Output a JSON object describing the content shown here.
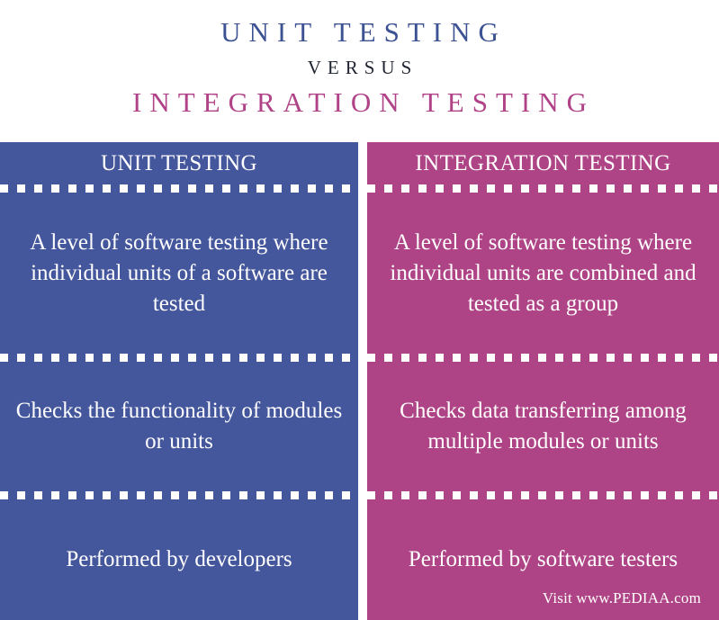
{
  "title": {
    "primary": "UNIT TESTING",
    "versus": "VERSUS",
    "secondary": "INTEGRATION TESTING"
  },
  "colors": {
    "unit_blue": "#44569C",
    "integration_pink": "#AE4486",
    "title_blue": "#3D5293",
    "title_pink": "#B04287",
    "versus_dark": "#1F2430",
    "text_white": "#FFFFFF"
  },
  "table": {
    "headers": [
      "UNIT TESTING",
      "INTEGRATION TESTING"
    ],
    "rows": [
      {
        "unit": "A level of software testing where individual units of a software are tested",
        "integration": "A  level of software testing where individual units are combined and tested as a group"
      },
      {
        "unit": "Checks the functionality of modules or units",
        "integration": "Checks data transferring among multiple modules or units"
      },
      {
        "unit": "Performed by developers",
        "integration": "Performed by software testers"
      }
    ]
  },
  "footer": {
    "credit": "Visit www.PEDIAA.com"
  }
}
